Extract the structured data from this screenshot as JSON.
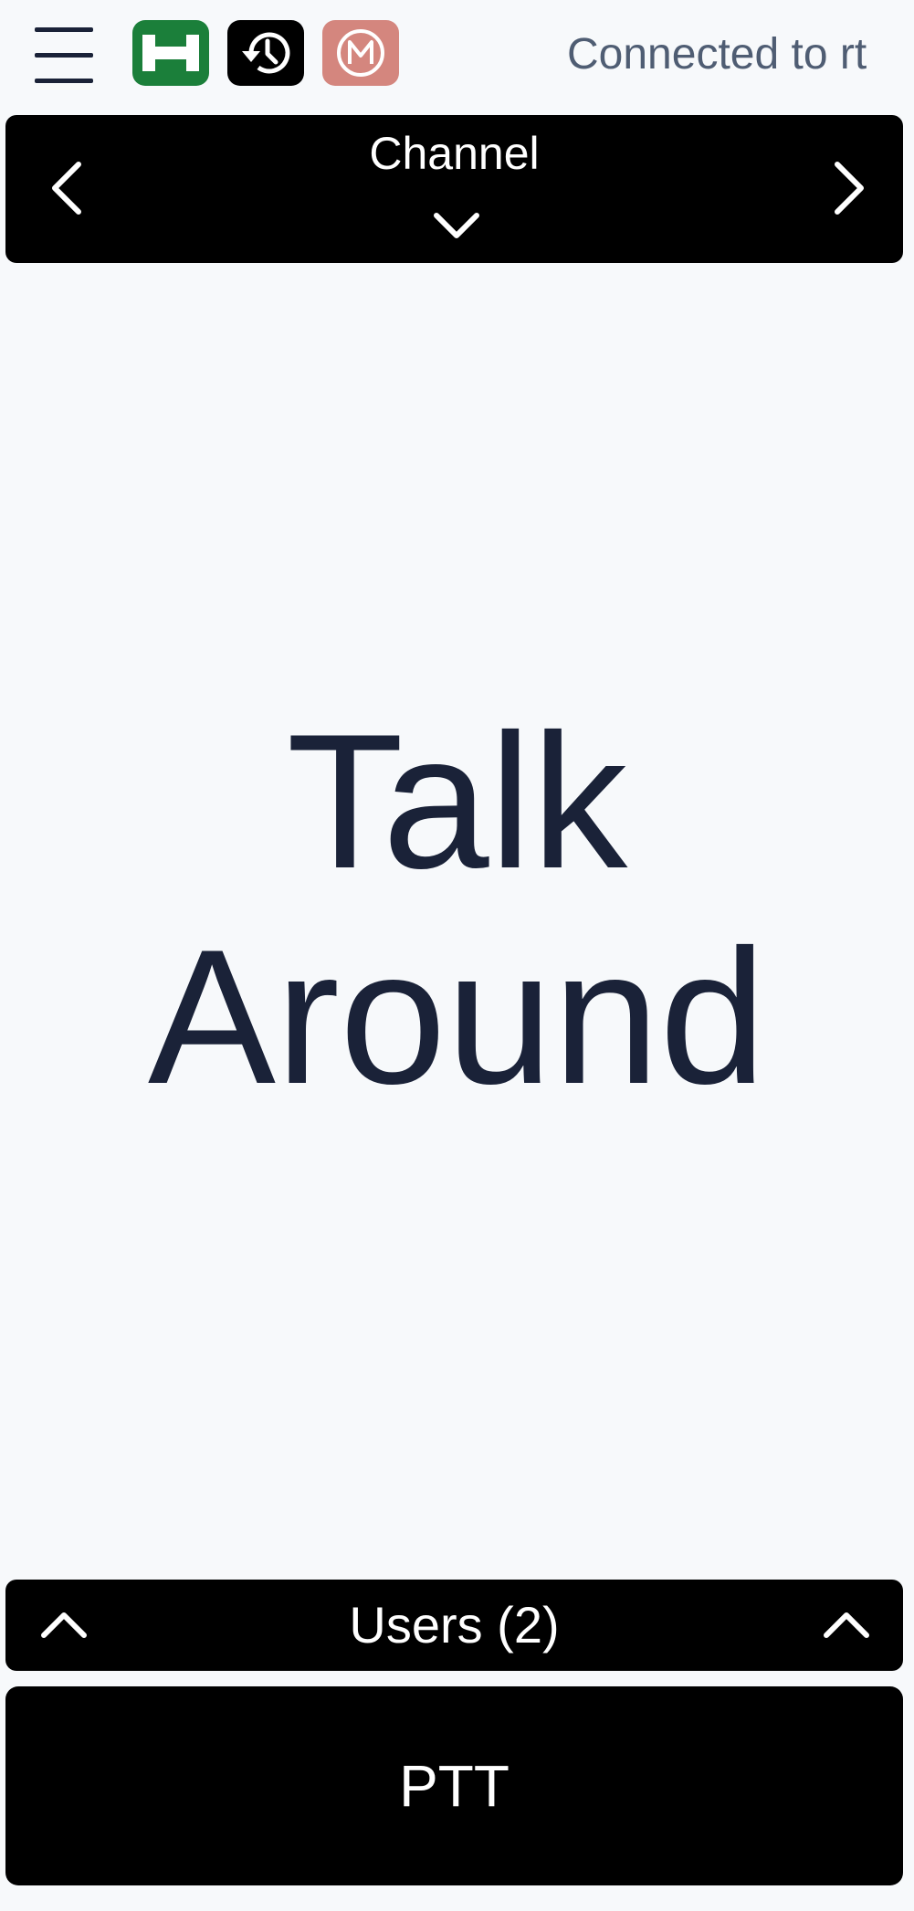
{
  "header": {
    "menu_icon": "hamburger-icon",
    "app_icons": [
      {
        "name": "h-icon",
        "color": "#1b7f3a"
      },
      {
        "name": "history-icon",
        "color": "#000000"
      },
      {
        "name": "m-icon",
        "color": "#d4867e"
      }
    ],
    "connection_status": "Connected to rt"
  },
  "channel_bar": {
    "label": "Channel",
    "prev_icon": "chevron-left-icon",
    "next_icon": "chevron-right-icon",
    "dropdown_icon": "chevron-down-icon"
  },
  "main": {
    "channel_name_line1": "Talk",
    "channel_name_line2": "Around"
  },
  "users_bar": {
    "label": "Users (2)",
    "expand_icon": "chevron-up-icon"
  },
  "ptt": {
    "label": "PTT"
  },
  "colors": {
    "background": "#f7f9fb",
    "text_primary": "#1a2238",
    "status_text": "#4f5d73",
    "bar_background": "#000000"
  }
}
